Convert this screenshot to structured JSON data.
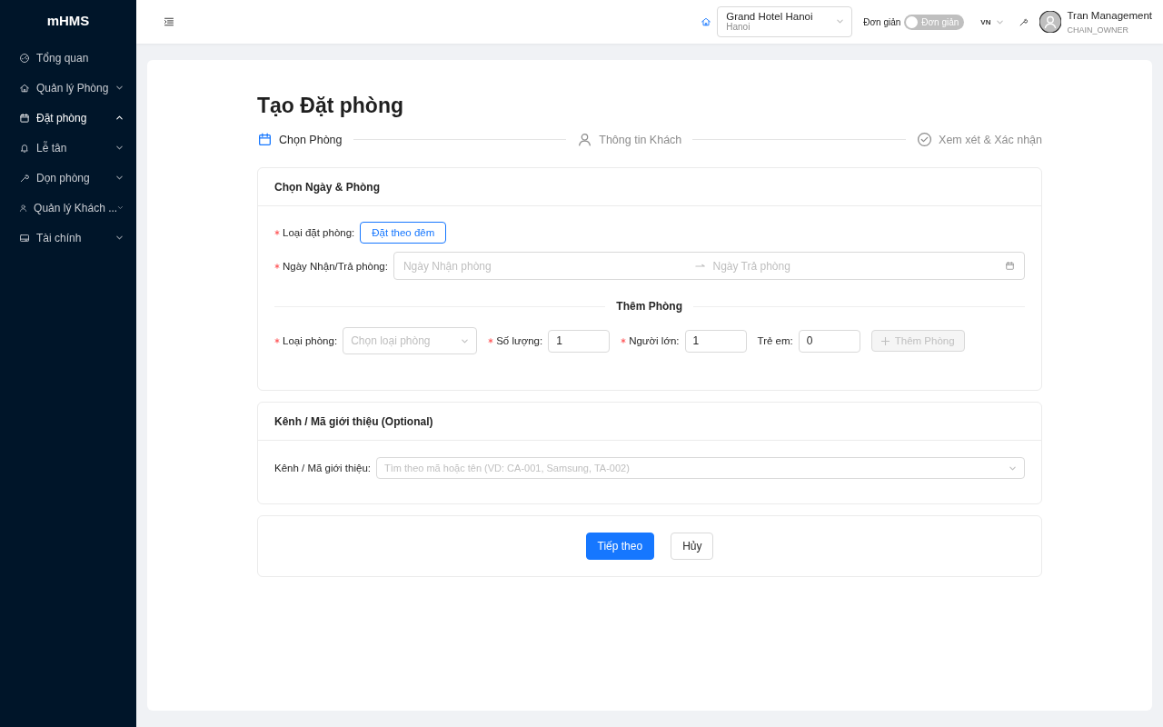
{
  "sidebar": {
    "logo": "mHMS",
    "items": [
      {
        "label": "Tổng quan",
        "selected": false
      },
      {
        "label": "Quản lý Phòng",
        "selected": false,
        "expanded": false
      },
      {
        "label": "Đặt phòng",
        "selected": true,
        "expanded": true
      },
      {
        "label": "Lễ tân",
        "selected": false,
        "expanded": false
      },
      {
        "label": "Dọn phòng",
        "selected": false,
        "expanded": false
      },
      {
        "label": "Quản lý Khách ...",
        "selected": false,
        "expanded": false
      },
      {
        "label": "Tài chính",
        "selected": false,
        "expanded": false
      }
    ]
  },
  "header": {
    "hotel": {
      "name": "Grand Hotel Hanoi",
      "city": "Hanoi"
    },
    "mode_label": "Đơn giản",
    "mode_switch": {
      "text": "Đơn giản",
      "on": false
    },
    "language": "VN",
    "user": {
      "name": "Tran Management",
      "role": "CHAIN_OWNER"
    }
  },
  "page": {
    "title": "Tạo Đặt phòng",
    "steps": [
      {
        "label": "Chọn Phòng",
        "selected": true
      },
      {
        "label": "Thông tin Khách",
        "selected": false
      },
      {
        "label": "Xem xét & Xác nhận",
        "selected": false
      }
    ]
  },
  "dates_card": {
    "title": "Chọn Ngày & Phòng",
    "booking_type": {
      "label": "Loại đặt phòng:",
      "required": true,
      "value": "Đặt theo đêm"
    },
    "date_range": {
      "label": "Ngày Nhận/Trả phòng:",
      "required": true,
      "start_placeholder": "Ngày Nhận phòng",
      "end_placeholder": "Ngày Trả phòng"
    },
    "divider": "Thêm Phòng",
    "room_fields": [
      {
        "kind": "select",
        "label": "Loại phòng:",
        "required": true,
        "placeholder": "Chọn loại phòng"
      },
      {
        "kind": "number",
        "label": "Số lượng:",
        "required": true,
        "value": "1"
      },
      {
        "kind": "number",
        "label": "Người lớn:",
        "required": true,
        "value": "1"
      },
      {
        "kind": "number",
        "label": "Trẻ em:",
        "required": false,
        "value": "0"
      }
    ],
    "add_button": {
      "label": "Thêm Phòng",
      "disabled": true
    }
  },
  "channel_card": {
    "title": "Kênh / Mã giới thiệu (Optional)",
    "label": "Kênh / Mã giới thiệu:",
    "placeholder": "Tìm theo mã hoặc tên (VD: CA-001, Samsung, TA-002)"
  },
  "actions": [
    {
      "kind": "primary",
      "label": "Tiếp theo"
    },
    {
      "kind": "default",
      "label": "Hủy"
    }
  ]
}
